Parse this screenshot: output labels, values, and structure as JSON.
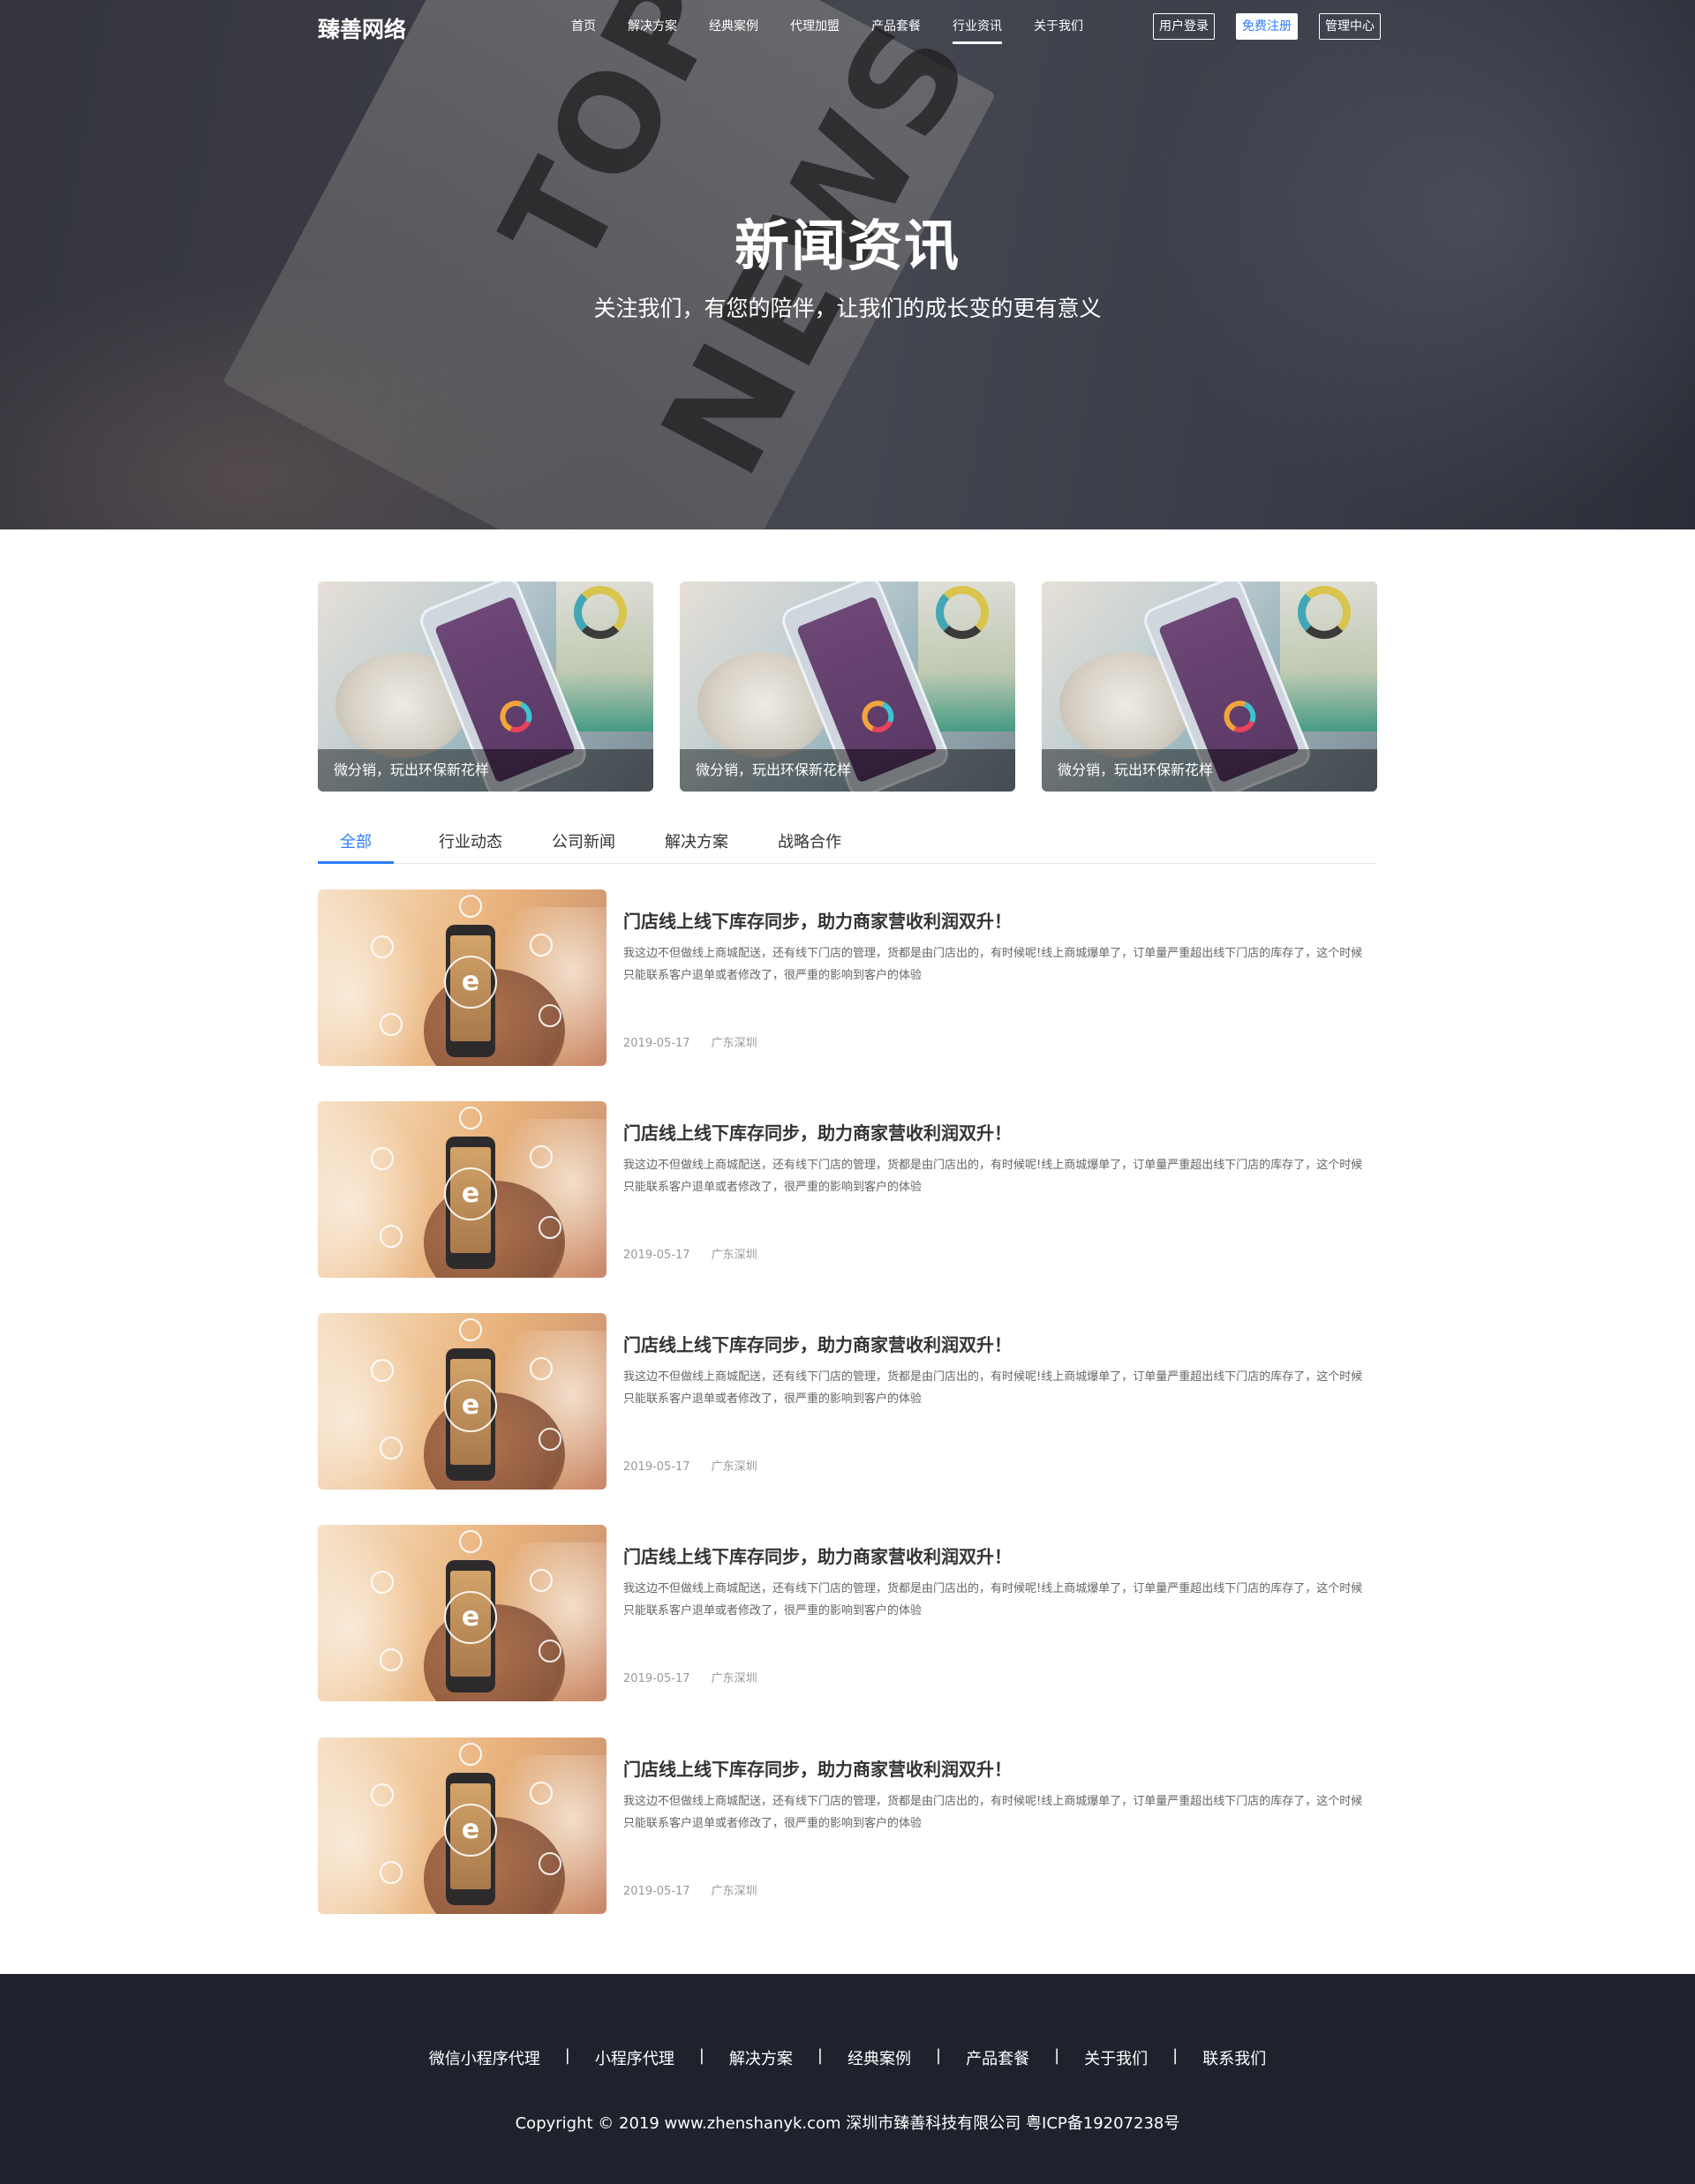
{
  "brand": {
    "logo": "臻善网络",
    "accent": "#2d7ff9",
    "footer_bg": "#1e222c"
  },
  "nav": {
    "items": [
      {
        "label": "首页"
      },
      {
        "label": "解决方案"
      },
      {
        "label": "经典案例"
      },
      {
        "label": "代理加盟"
      },
      {
        "label": "产品套餐"
      },
      {
        "label": "行业资讯",
        "active": true
      },
      {
        "label": "关于我们"
      }
    ],
    "login": "用户登录",
    "register": "免费注册",
    "admin": "管理中心"
  },
  "hero": {
    "paper_line1": "TOP",
    "paper_line2": "NEWS",
    "title": "新闻资讯",
    "subtitle": "关注我们，有您的陪伴，让我们的成长变的更有意义"
  },
  "featured": [
    {
      "caption": "微分销，玩出环保新花样"
    },
    {
      "caption": "微分销，玩出环保新花样"
    },
    {
      "caption": "微分销，玩出环保新花样"
    }
  ],
  "tabs": [
    {
      "label": "全部",
      "active": true
    },
    {
      "label": "行业动态"
    },
    {
      "label": "公司新闻"
    },
    {
      "label": "解决方案"
    },
    {
      "label": "战略合作"
    }
  ],
  "news": [
    {
      "title": "门店线上线下库存同步，助力商家营收利润双升！",
      "desc": "我这边不但做线上商城配送，还有线下门店的管理，货都是由门店出的，有时候呢!线上商城爆单了，订单量严重超出线下门店的库存了，这个时候只能联系客户退单或者修改了，很严重的影响到客户的体验",
      "date": "2019-05-17",
      "location": "广东深圳"
    },
    {
      "title": "门店线上线下库存同步，助力商家营收利润双升！",
      "desc": "我这边不但做线上商城配送，还有线下门店的管理，货都是由门店出的，有时候呢!线上商城爆单了，订单量严重超出线下门店的库存了，这个时候只能联系客户退单或者修改了，很严重的影响到客户的体验",
      "date": "2019-05-17",
      "location": "广东深圳"
    },
    {
      "title": "门店线上线下库存同步，助力商家营收利润双升！",
      "desc": "我这边不但做线上商城配送，还有线下门店的管理，货都是由门店出的，有时候呢!线上商城爆单了，订单量严重超出线下门店的库存了，这个时候只能联系客户退单或者修改了，很严重的影响到客户的体验",
      "date": "2019-05-17",
      "location": "广东深圳"
    },
    {
      "title": "门店线上线下库存同步，助力商家营收利润双升！",
      "desc": "我这边不但做线上商城配送，还有线下门店的管理，货都是由门店出的，有时候呢!线上商城爆单了，订单量严重超出线下门店的库存了，这个时候只能联系客户退单或者修改了，很严重的影响到客户的体验",
      "date": "2019-05-17",
      "location": "广东深圳"
    },
    {
      "title": "门店线上线下库存同步，助力商家营收利润双升！",
      "desc": "我这边不但做线上商城配送，还有线下门店的管理，货都是由门店出的，有时候呢!线上商城爆单了，订单量严重超出线下门店的库存了，这个时候只能联系客户退单或者修改了，很严重的影响到客户的体验",
      "date": "2019-05-17",
      "location": "广东深圳"
    }
  ],
  "footer": {
    "links": [
      {
        "label": "微信小程序代理"
      },
      {
        "label": "小程序代理"
      },
      {
        "label": "解决方案"
      },
      {
        "label": "经典案例"
      },
      {
        "label": "产品套餐"
      },
      {
        "label": "关于我们"
      },
      {
        "label": "联系我们"
      }
    ],
    "separator": "|",
    "copyright": "Copyright  ©  2019 www.zhenshanyk.com  深圳市臻善科技有限公司  粤ICP备19207238号"
  }
}
